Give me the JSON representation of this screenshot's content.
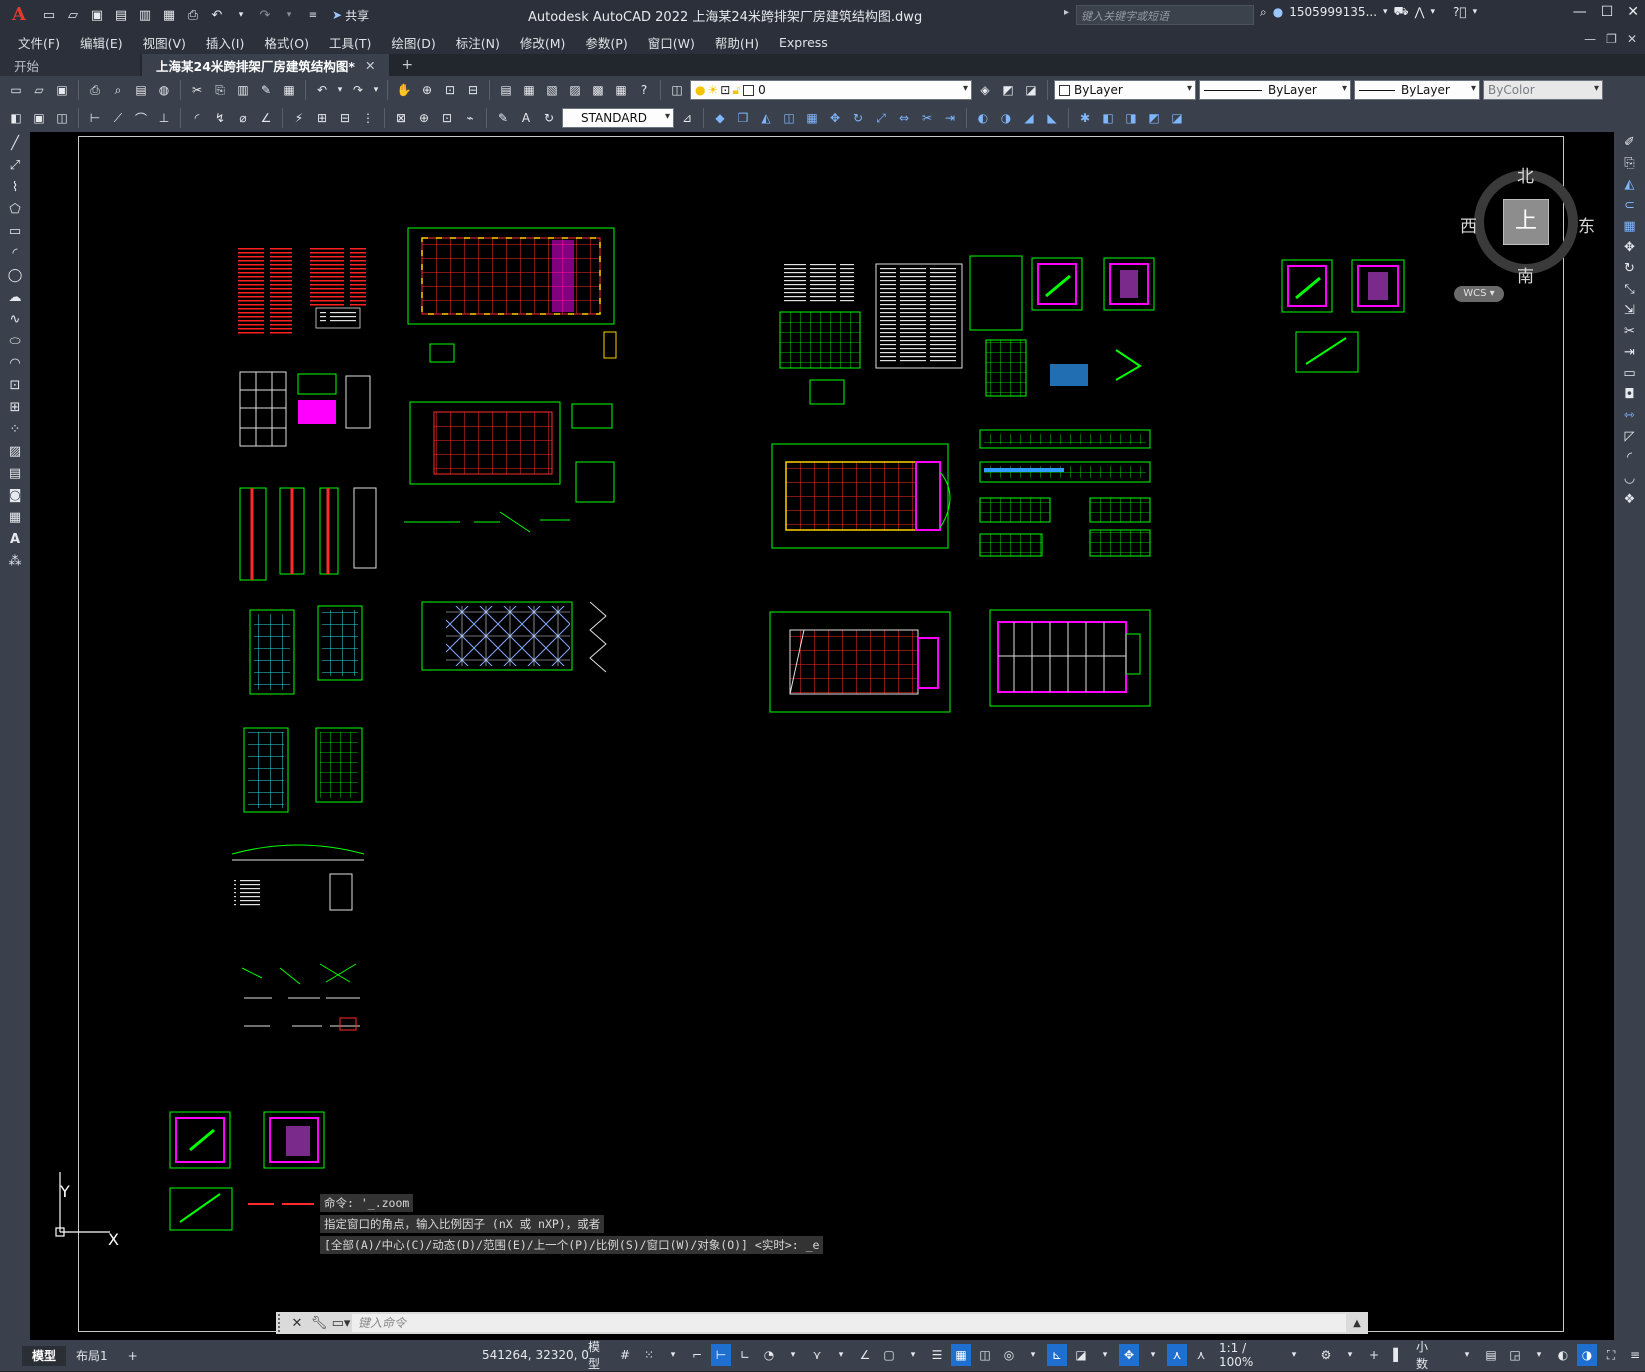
{
  "app": {
    "window_title": "Autodesk AutoCAD 2022    上海某24米跨排架厂房建筑结构图.dwg",
    "share_label": "共享",
    "search_placeholder": "键入关键字或短语",
    "user_label": "1505999135...",
    "logo_glyph": "A"
  },
  "menu": [
    "文件(F)",
    "编辑(E)",
    "视图(V)",
    "插入(I)",
    "格式(O)",
    "工具(T)",
    "绘图(D)",
    "标注(N)",
    "修改(M)",
    "参数(P)",
    "窗口(W)",
    "帮助(H)",
    "Express"
  ],
  "tabs": [
    {
      "label": "开始",
      "active": false
    },
    {
      "label": "上海某24米跨排架厂房建筑结构图*",
      "active": true
    }
  ],
  "properties": {
    "layer": "0",
    "color": "ByLayer",
    "linetype": "ByLayer",
    "lineweight": "ByLayer",
    "plotstyle": "ByColor",
    "text_style": "STANDARD"
  },
  "viewcube": {
    "face": "上",
    "north": "北",
    "south": "南",
    "west": "西",
    "east": "东",
    "wcs": "WCS"
  },
  "ucs": {
    "x": "X",
    "y": "Y"
  },
  "command": {
    "history": [
      "命令: '_.zoom",
      "指定窗口的角点，输入比例因子 (nX 或 nXP)，或者",
      "[全部(A)/中心(C)/动态(D)/范围(E)/上一个(P)/比例(S)/窗口(W)/对象(O)] <实时>: _e"
    ],
    "placeholder": "键入命令"
  },
  "layouts": [
    {
      "label": "模型",
      "active": true
    },
    {
      "label": "布局1",
      "active": false
    }
  ],
  "status": {
    "coords": "541264, 32320, 0",
    "mode": "模型",
    "scale": "1:1 / 100%",
    "units": "小数"
  },
  "colors": {
    "ui_dark": "#2b303a",
    "ui_panel": "#3b414c",
    "canvas": "#000000",
    "drawing_green": "#00ff00",
    "drawing_magenta": "#ff00ff",
    "drawing_red": "#ff2020",
    "active_blue": "#1f6fd1"
  }
}
